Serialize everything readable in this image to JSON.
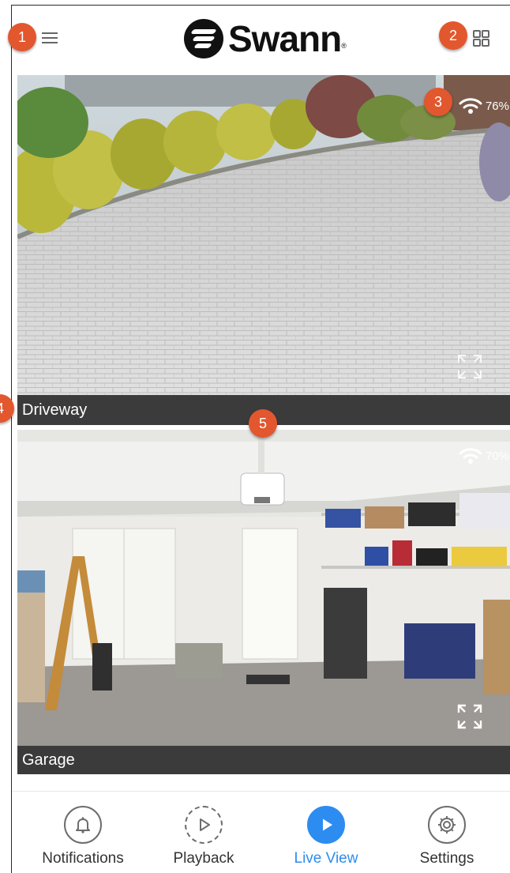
{
  "header": {
    "logo_text": "Swann",
    "logo_tm": "®",
    "menu_icon": "hamburger-menu-icon",
    "layout_icon": "grid-layout-icon"
  },
  "callouts": [
    "1",
    "2",
    "3",
    "4",
    "5"
  ],
  "cameras": [
    {
      "name": "Driveway",
      "signal": "76%",
      "signal_icon": "wifi-icon",
      "expand_icon": "fullscreen-expand-icon"
    },
    {
      "name": "Garage",
      "signal": "70%",
      "signal_icon": "wifi-icon",
      "expand_icon": "fullscreen-expand-icon"
    }
  ],
  "tabs": [
    {
      "label": "Notifications",
      "icon": "bell-icon",
      "active": false
    },
    {
      "label": "Playback",
      "icon": "playback-icon",
      "active": false
    },
    {
      "label": "Live View",
      "icon": "play-icon",
      "active": true
    },
    {
      "label": "Settings",
      "icon": "gear-icon",
      "active": false
    }
  ],
  "colors": {
    "accent": "#2d8cf0",
    "callout": "#e2572e",
    "label_bar": "#3b3b3b"
  }
}
